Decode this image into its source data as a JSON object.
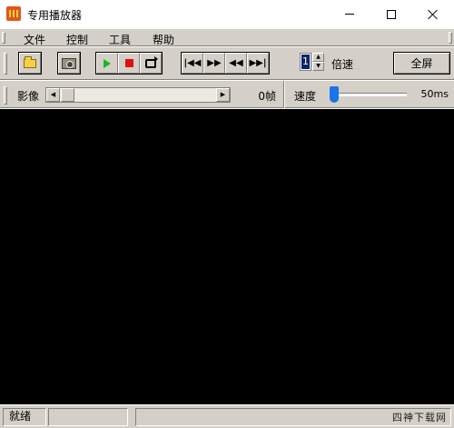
{
  "window": {
    "title": "专用播放器"
  },
  "menu": {
    "items": [
      "文件",
      "控制",
      "工具",
      "帮助"
    ]
  },
  "toolbar": {
    "icons": [
      "open-folder-icon",
      "camera-icon",
      "play-icon",
      "stop-icon",
      "loop-icon",
      "skip-start-icon",
      "fast-forward-icon",
      "rewind-icon",
      "skip-end-icon"
    ],
    "skip_start": "|◀◀",
    "fast_forward": "▶▶",
    "rewind": "◀◀",
    "skip_end": "▶▶|",
    "speed_multiplier": "1",
    "speed_multiplier_label": "倍速",
    "fullscreen_label": "全屏"
  },
  "seek": {
    "image_label": "影像",
    "frame_count": "0帧",
    "speed_label": "速度",
    "speed_value": "50ms"
  },
  "status": {
    "text": "就绪"
  },
  "watermark": "四神下载网",
  "colors": {
    "play": "#17b817",
    "stop": "#e01010",
    "slider_thumb": "#1a73e8",
    "video_background": "#000000"
  }
}
